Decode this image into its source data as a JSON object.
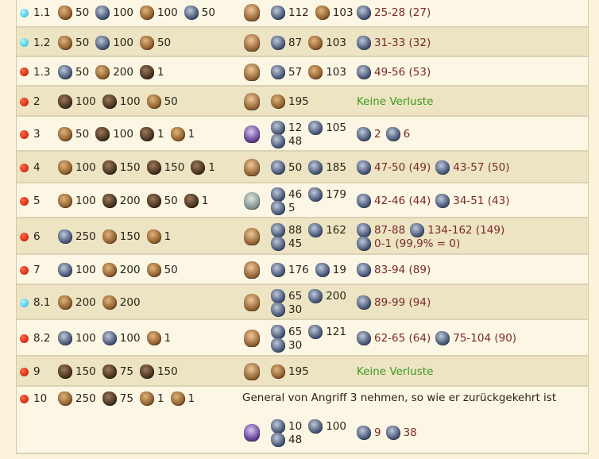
{
  "rows": [
    {
      "id": "1.1",
      "dot": "cyan",
      "units": [
        {
          "icon": "recruit-icon",
          "n": "50"
        },
        {
          "icon": "militia-icon",
          "n": "100"
        },
        {
          "icon": "bowman-icon",
          "n": "100"
        },
        {
          "icon": "soldier-icon",
          "n": "50"
        }
      ],
      "general": "general-icon",
      "army": [
        [
          {
            "icon": "soldier-icon",
            "n": "112"
          },
          {
            "icon": "cavalry-icon",
            "n": "103"
          }
        ]
      ],
      "losses": [
        [
          {
            "icon": "soldier-icon",
            "t": "25-28 (27)"
          }
        ]
      ]
    },
    {
      "id": "1.2",
      "dot": "cyan",
      "units": [
        {
          "icon": "recruit-icon",
          "n": "50"
        },
        {
          "icon": "soldier-icon",
          "n": "100"
        },
        {
          "icon": "bowman-icon",
          "n": "50"
        }
      ],
      "general": "general-icon",
      "army": [
        [
          {
            "icon": "soldier-icon",
            "n": "87"
          },
          {
            "icon": "cavalry-icon",
            "n": "103"
          }
        ]
      ],
      "losses": [
        [
          {
            "icon": "soldier-icon",
            "t": "31-33 (32)"
          }
        ]
      ]
    },
    {
      "id": "1.3",
      "dot": "red",
      "units": [
        {
          "icon": "militia-icon",
          "n": "50"
        },
        {
          "icon": "bowman-icon",
          "n": "200"
        },
        {
          "icon": "pot-icon",
          "n": "1"
        }
      ],
      "general": "general-icon",
      "army": [
        [
          {
            "icon": "soldier-icon",
            "n": "57"
          },
          {
            "icon": "cavalry-icon",
            "n": "103"
          }
        ]
      ],
      "losses": [
        [
          {
            "icon": "soldier-icon",
            "t": "49-56 (53)"
          }
        ]
      ]
    },
    {
      "id": "2",
      "dot": "red",
      "units": [
        {
          "icon": "boar-icon",
          "n": "100"
        },
        {
          "icon": "bear-icon",
          "n": "100"
        },
        {
          "icon": "lion-icon",
          "n": "50"
        }
      ],
      "general": "general-icon",
      "army": [
        [
          {
            "icon": "cavalry-icon",
            "n": "195"
          }
        ]
      ],
      "ok": "Keine Verluste"
    },
    {
      "id": "3",
      "dot": "red",
      "units": [
        {
          "icon": "fox-icon",
          "n": "50"
        },
        {
          "icon": "wolf-icon",
          "n": "100"
        },
        {
          "icon": "bear-cub-icon",
          "n": "1"
        },
        {
          "icon": "beast-icon",
          "n": "1"
        }
      ],
      "general": "mage-icon",
      "army": [
        [
          {
            "icon": "soldier-icon",
            "n": "12"
          },
          {
            "icon": "knight-icon",
            "n": "105"
          }
        ],
        [
          {
            "icon": "archer-icon",
            "n": "48"
          }
        ]
      ],
      "losses": [
        [
          {
            "icon": "soldier-icon",
            "t": "2"
          },
          {
            "icon": "knight-icon",
            "t": "6"
          }
        ]
      ]
    },
    {
      "id": "4",
      "dot": "red",
      "units": [
        {
          "icon": "fox-icon",
          "n": "100"
        },
        {
          "icon": "bear-cub-icon",
          "n": "150"
        },
        {
          "icon": "bear-icon",
          "n": "150"
        },
        {
          "icon": "boar-icon",
          "n": "1"
        }
      ],
      "general": "general-icon",
      "army": [
        [
          {
            "icon": "soldier-icon",
            "n": "50"
          },
          {
            "icon": "knight-icon",
            "n": "185"
          }
        ]
      ],
      "losses": [
        [
          {
            "icon": "soldier-icon",
            "t": "47-50 (49)"
          },
          {
            "icon": "knight-icon",
            "t": "43-57 (50)"
          }
        ]
      ]
    },
    {
      "id": "5",
      "dot": "red",
      "units": [
        {
          "icon": "fox-icon",
          "n": "100"
        },
        {
          "icon": "bear-cub-icon",
          "n": "200"
        },
        {
          "icon": "bear-icon",
          "n": "50"
        },
        {
          "icon": "hound-icon",
          "n": "1"
        }
      ],
      "general": "ghost-icon",
      "army": [
        [
          {
            "icon": "soldier-icon",
            "n": "46"
          },
          {
            "icon": "knight-icon",
            "n": "179"
          }
        ],
        [
          {
            "icon": "archer-icon",
            "n": "5"
          }
        ]
      ],
      "losses": [
        [
          {
            "icon": "soldier-icon",
            "t": "42-46 (44)"
          },
          {
            "icon": "knight-icon",
            "t": "34-51 (43)"
          }
        ]
      ]
    },
    {
      "id": "6",
      "dot": "red",
      "units": [
        {
          "icon": "soldier-icon",
          "n": "250"
        },
        {
          "icon": "bowman-icon",
          "n": "150"
        },
        {
          "icon": "captain-icon",
          "n": "1"
        }
      ],
      "general": "general-icon",
      "army": [
        [
          {
            "icon": "soldier-icon",
            "n": "88"
          },
          {
            "icon": "knight-icon",
            "n": "162"
          }
        ],
        [
          {
            "icon": "archer-icon",
            "n": "45"
          }
        ]
      ],
      "losses": [
        [
          {
            "icon": "soldier-icon",
            "t": "87-88"
          },
          {
            "icon": "knight-icon",
            "t": "134-162 (149)"
          }
        ],
        [
          {
            "icon": "archer-icon",
            "t": "0-1 (99,9% = 0)"
          }
        ]
      ]
    },
    {
      "id": "7",
      "dot": "red",
      "units": [
        {
          "icon": "soldier-icon",
          "n": "100"
        },
        {
          "icon": "bowman-icon",
          "n": "200"
        },
        {
          "icon": "cannoneer-icon",
          "n": "50"
        }
      ],
      "general": "general-icon",
      "army": [
        [
          {
            "icon": "knight-icon",
            "n": "176"
          },
          {
            "icon": "archer-icon",
            "n": "19"
          }
        ]
      ],
      "losses": [
        [
          {
            "icon": "knight-icon",
            "t": "83-94 (89)"
          }
        ]
      ]
    },
    {
      "id": "8.1",
      "dot": "cyan",
      "units": [
        {
          "icon": "bowman-icon",
          "n": "200"
        },
        {
          "icon": "cannoneer-icon",
          "n": "200"
        }
      ],
      "general": "general-icon",
      "army": [
        [
          {
            "icon": "soldier-icon",
            "n": "65"
          },
          {
            "icon": "knight-icon",
            "n": "200"
          }
        ],
        [
          {
            "icon": "archer-icon",
            "n": "30"
          }
        ]
      ],
      "losses": [
        [
          {
            "icon": "knight-icon",
            "t": "89-99 (94)"
          }
        ]
      ]
    },
    {
      "id": "8.2",
      "dot": "red",
      "units": [
        {
          "icon": "soldier-icon",
          "n": "100"
        },
        {
          "icon": "militia-icon",
          "n": "100"
        },
        {
          "icon": "chief-icon",
          "n": "1"
        }
      ],
      "general": "general-icon",
      "army": [
        [
          {
            "icon": "soldier-icon",
            "n": "65"
          },
          {
            "icon": "knight-icon",
            "n": "121"
          }
        ],
        [
          {
            "icon": "archer-icon",
            "n": "30"
          }
        ]
      ],
      "losses": [
        [
          {
            "icon": "soldier-icon",
            "t": "62-65 (64)"
          },
          {
            "icon": "knight-icon",
            "t": "75-104 (90)"
          }
        ]
      ]
    },
    {
      "id": "9",
      "dot": "red",
      "units": [
        {
          "icon": "wolf-icon",
          "n": "150"
        },
        {
          "icon": "bear-cub-icon",
          "n": "75"
        },
        {
          "icon": "bear-icon",
          "n": "150"
        }
      ],
      "general": "general-icon",
      "army": [
        [
          {
            "icon": "cavalry-icon",
            "n": "195"
          }
        ]
      ],
      "ok": "Keine Verluste"
    },
    {
      "id": "10",
      "dot": "red",
      "units": [
        {
          "icon": "fox-icon",
          "n": "250"
        },
        {
          "icon": "bear-cub-icon",
          "n": "75"
        },
        {
          "icon": "king-icon",
          "n": "1"
        },
        {
          "icon": "chief-icon",
          "n": "1"
        }
      ],
      "note": "General von Angriff 3 nehmen, so wie er zurückgekehrt ist",
      "general": "mage-icon",
      "army": [
        [
          {
            "icon": "soldier-icon",
            "n": "10"
          },
          {
            "icon": "knight-icon",
            "n": "100"
          }
        ],
        [
          {
            "icon": "archer-icon",
            "n": "48"
          }
        ]
      ],
      "losses": [
        [
          {
            "icon": "soldier-icon",
            "t": "9"
          },
          {
            "icon": "knight-icon",
            "t": "38"
          }
        ]
      ]
    }
  ]
}
